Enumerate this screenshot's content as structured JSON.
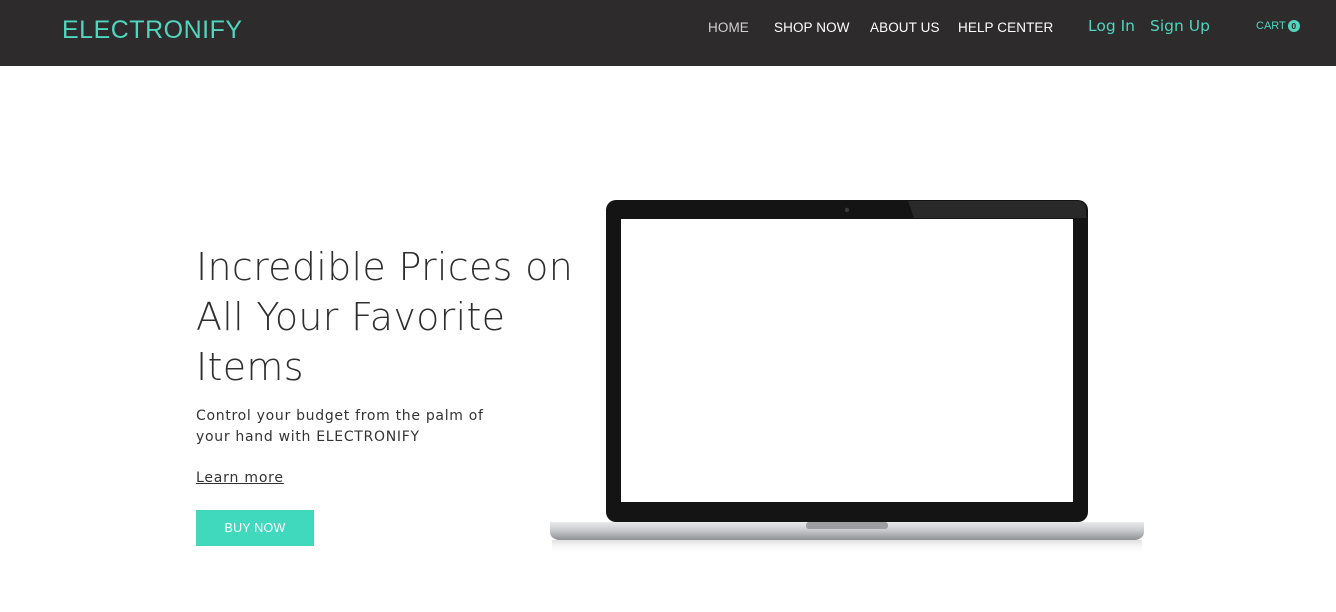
{
  "header": {
    "logo": "ELECTRONIFY",
    "nav": [
      {
        "label": "HOME",
        "active": true
      },
      {
        "label": "SHOP NOW"
      },
      {
        "label": "ABOUT US"
      },
      {
        "label": "HELP CENTER"
      }
    ],
    "login_label": "Log In",
    "signup_label": "Sign Up",
    "cart_label": "CART",
    "cart_count": "0"
  },
  "hero": {
    "heading_line1": "Incredible Prices on",
    "heading_line2": "All Your Favorite",
    "heading_line3": "Items",
    "sub_line1": "Control your budget from the palm of",
    "sub_line2": "your hand with ELECTRONIFY",
    "learn_more_label": "Learn more",
    "buy_now_label": "BUY NOW"
  },
  "colors": {
    "accent": "#4fd6bd",
    "header_bg": "#2d2b2c",
    "button_bg": "#40d9bd"
  }
}
